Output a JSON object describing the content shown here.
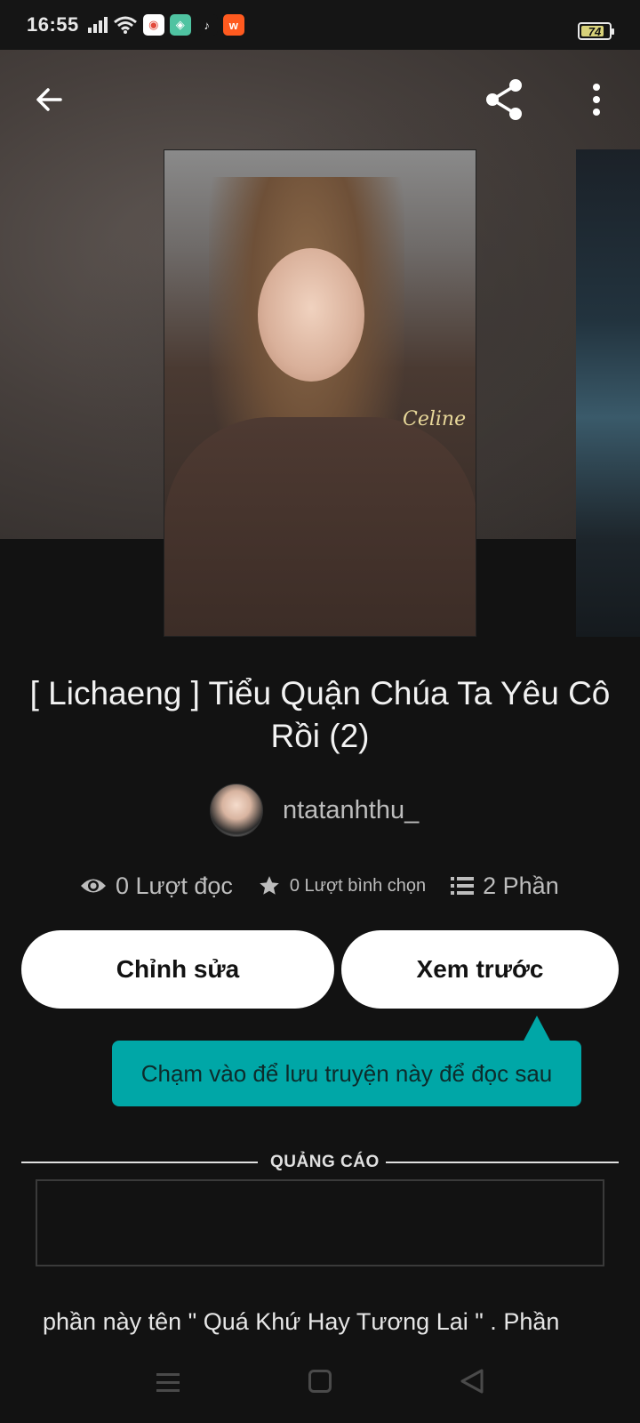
{
  "status_bar": {
    "time": "16:55",
    "battery": "74",
    "apps": [
      {
        "name": "chrome-app-icon",
        "bg": "#ffffff",
        "glyph": "◉",
        "color": "#e24a3b"
      },
      {
        "name": "green-app-icon",
        "bg": "#4fc3a1",
        "glyph": "◈",
        "color": "#ffffff"
      },
      {
        "name": "tiktok-app-icon",
        "bg": "#151515",
        "glyph": "♪",
        "color": "#ffffff"
      },
      {
        "name": "wattpad-app-icon",
        "bg": "#ff5a1f",
        "glyph": "w",
        "color": "#ffffff"
      }
    ]
  },
  "header": {
    "back_icon": "arrow-left-icon",
    "share_icon": "share-icon",
    "more_icon": "more-vertical-icon"
  },
  "cover": {
    "script_text": "Celine"
  },
  "story": {
    "title": "[ Lichaeng ] Tiểu Quận Chúa Ta Yêu Cô Rồi (2)",
    "author": "ntatanhthu_"
  },
  "stats": {
    "reads": "0 Lượt đọc",
    "votes": "0 Lượt bình chọn",
    "parts": "2 Phần"
  },
  "actions": {
    "edit_label": "Chỉnh sửa",
    "preview_label": "Xem trước"
  },
  "tooltip": {
    "text": "Chạm vào để lưu truyện này để đọc sau"
  },
  "ad": {
    "label": "QUẢNG CÁO"
  },
  "description": {
    "text": "phần này tên \" Quá Khứ Hay Tương Lai \" . Phần"
  },
  "colors": {
    "accent": "#00a7a7",
    "background": "#121212",
    "button": "#ffffff"
  }
}
